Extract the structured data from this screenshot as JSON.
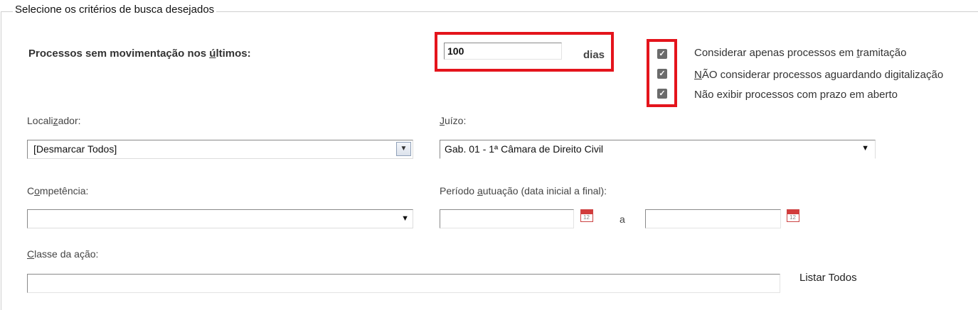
{
  "legend": "Selecione os critérios de busca desejados",
  "processos_label": {
    "pre": "Processos sem movimentação nos ",
    "underlined": "ú",
    "post": "ltimos:"
  },
  "dias_value": "100",
  "dias_label": "dias",
  "checkboxes": [
    {
      "pre": "Considerar apenas processos em ",
      "underlined": "t",
      "post": "ramitação",
      "checked": true
    },
    {
      "pre": "",
      "underlined": "N",
      "post": "ÃO considerar processos aguardando digitalização",
      "checked": true
    },
    {
      "pre": "Não exibir processos com prazo em aberto",
      "underlined": "",
      "post": "",
      "checked": true
    }
  ],
  "localizador": {
    "pre": "Locali",
    "underlined": "z",
    "post": "ador:",
    "value": "[Desmarcar Todos]"
  },
  "juizo": {
    "pre": "",
    "underlined": "J",
    "post": "uízo:",
    "value": "Gab. 01 - 1ª Câmara de Direito Civil"
  },
  "competencia": {
    "pre": "C",
    "underlined": "o",
    "post": "mpetência:",
    "value": ""
  },
  "periodo": {
    "pre": "Período ",
    "underlined": "a",
    "post": "utuação (data inicial a final):",
    "separator": "a"
  },
  "classe": {
    "pre": "",
    "underlined": "C",
    "post": "lasse da ação:",
    "value": ""
  },
  "listar_todos": "Listar Todos",
  "icons": {
    "checkbox": "checkmark-icon",
    "dropdown": "chevron-down-icon",
    "calendar": "calendar-icon"
  },
  "colors": {
    "highlight": "#e4141c",
    "checkbox": "#6b6b6b"
  }
}
